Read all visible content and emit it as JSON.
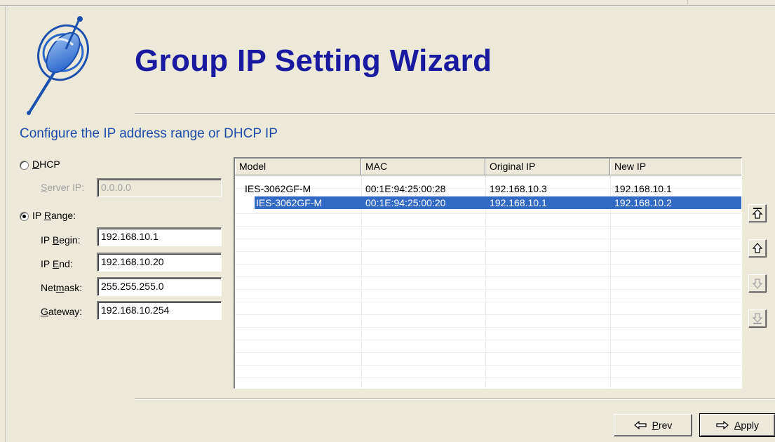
{
  "wizard": {
    "title": "Group IP Setting Wizard",
    "subtitle": "Configure the IP address range or DHCP IP"
  },
  "settings": {
    "dhcp": {
      "label_pre": "",
      "label_key": "D",
      "label_post": "HCP",
      "selected": false
    },
    "server_ip": {
      "label_pre": "",
      "label_key": "S",
      "label_post": "erver IP:",
      "value": "0.0.0.0",
      "enabled": false
    },
    "ip_range": {
      "label_pre": "IP ",
      "label_key": "R",
      "label_post": "ange:",
      "selected": true
    },
    "ip_begin": {
      "label_pre": "IP ",
      "label_key": "B",
      "label_post": "egin:",
      "value": "192.168.10.1"
    },
    "ip_end": {
      "label_pre": "IP ",
      "label_key": "E",
      "label_post": "nd:",
      "value": "192.168.10.20"
    },
    "netmask": {
      "label_pre": "Net",
      "label_key": "m",
      "label_post": "ask:",
      "value": "255.255.255.0"
    },
    "gateway": {
      "label_pre": "",
      "label_key": "G",
      "label_post": "ateway:",
      "value": "192.168.10.254"
    }
  },
  "table": {
    "columns": [
      "Model",
      "MAC",
      "Original IP",
      "New IP"
    ],
    "rows": [
      [
        "IES-3062GF-M",
        "00:1E:94:25:00:28",
        "192.168.10.3",
        "192.168.10.1"
      ],
      [
        "IES-3062GF-M",
        "00:1E:94:25:00:20",
        "192.168.10.1",
        "192.168.10.2"
      ]
    ],
    "selected_row": 1
  },
  "side_buttons": {
    "move_top": {
      "icon": "move-to-top-icon",
      "enabled": true
    },
    "move_up": {
      "icon": "move-up-icon",
      "enabled": true
    },
    "move_down": {
      "icon": "move-down-icon",
      "enabled": false
    },
    "move_bottom": {
      "icon": "move-to-bottom-icon",
      "enabled": false
    }
  },
  "footer": {
    "prev": {
      "key": "P",
      "rest": "rev",
      "icon": "arrow-left-icon"
    },
    "apply": {
      "key": "A",
      "rest": "pply",
      "icon": "arrow-right-icon"
    }
  },
  "colors": {
    "title": "#1a1aa0",
    "subtitle": "#1b4aa8",
    "selection": "#316ac5",
    "face": "#ece9d8"
  }
}
